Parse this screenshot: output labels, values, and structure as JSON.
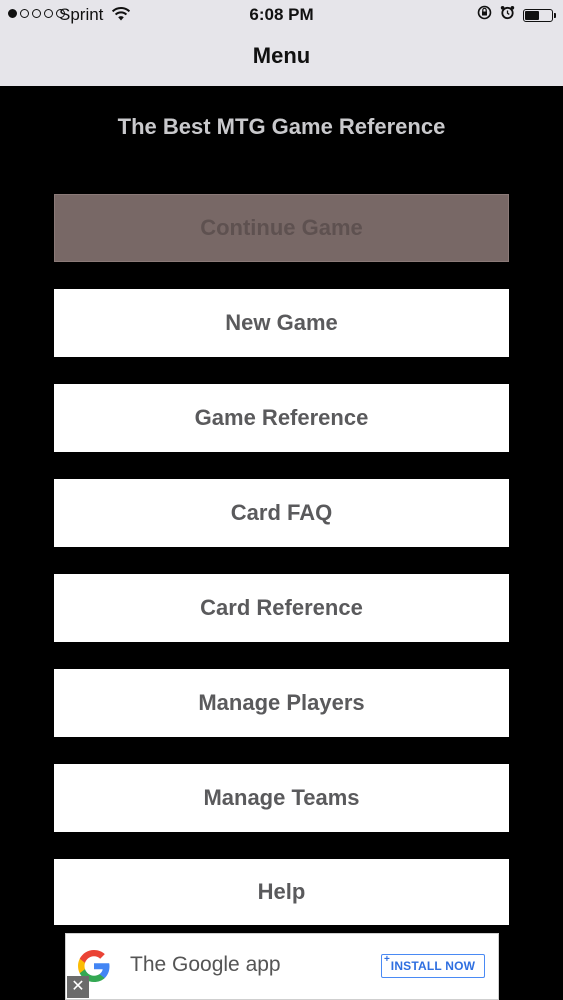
{
  "status_bar": {
    "carrier": "Sprint",
    "time": "6:08 PM",
    "battery_level": 0.55,
    "signal_dots_filled": 1,
    "signal_dots_total": 5
  },
  "nav": {
    "title": "Menu"
  },
  "header": {
    "subtitle": "The Best MTG Game Reference"
  },
  "menu": {
    "continue_game": "Continue Game",
    "new_game": "New Game",
    "game_reference": "Game Reference",
    "card_faq": "Card FAQ",
    "card_reference": "Card Reference",
    "manage_players": "Manage Players",
    "manage_teams": "Manage Teams",
    "help": "Help"
  },
  "ad": {
    "app_name": "The Google app",
    "install_label": "INSTALL NOW",
    "close_glyph": "✕"
  },
  "colors": {
    "background": "#000000",
    "nav_bar": "#e6e5ea",
    "button_bg": "#ffffff",
    "button_text": "#5a5a5c",
    "disabled_bg": "#786866",
    "subtitle_text": "#c9c9cc",
    "install_blue": "#2f6fe0"
  }
}
